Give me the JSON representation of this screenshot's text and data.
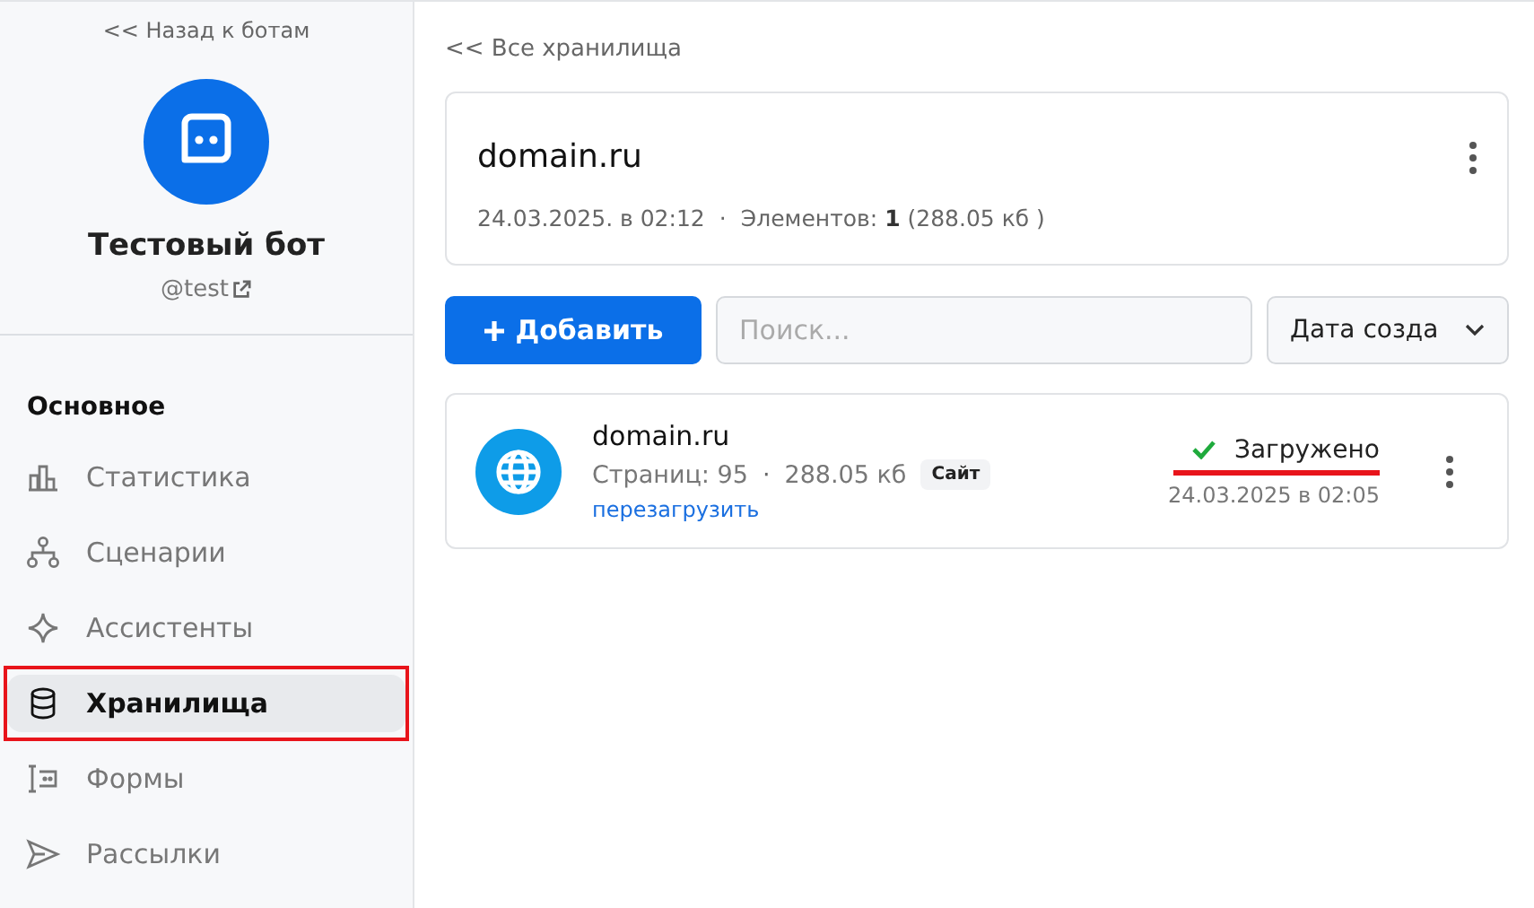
{
  "sidebar": {
    "back_link": "<< Назад к ботам",
    "bot_name": "Тестовый бот",
    "bot_handle": "@test",
    "section_title": "Основное",
    "items": [
      {
        "label": "Статистика",
        "selected": false,
        "annotated": false
      },
      {
        "label": "Сценарии",
        "selected": false,
        "annotated": false
      },
      {
        "label": "Ассистенты",
        "selected": false,
        "annotated": false
      },
      {
        "label": "Хранилища",
        "selected": true,
        "annotated": true
      },
      {
        "label": "Формы",
        "selected": false,
        "annotated": false
      },
      {
        "label": "Рассылки",
        "selected": false,
        "annotated": false
      }
    ]
  },
  "main": {
    "back_link": "<< Все хранилища",
    "storage": {
      "title": "domain.ru",
      "date": "24.03.2025. в 02:12",
      "separator": "·",
      "summary": "Элементов: **1** (288.05 кб )"
    },
    "toolbar": {
      "add_button": "Добавить",
      "search": {
        "placeholder": "Поиск..."
      },
      "sort": "Дата созда"
    },
    "items": [
      {
        "title": "domain.ru",
        "pages": "Страниц: 95",
        "separator": "·",
        "size": "288.05 кб",
        "tag": "Сайт",
        "reload_link": "перезагрузить",
        "status": "Загружено",
        "status_underlined": true,
        "date": "24.03.2025 в 02:05"
      }
    ]
  }
}
